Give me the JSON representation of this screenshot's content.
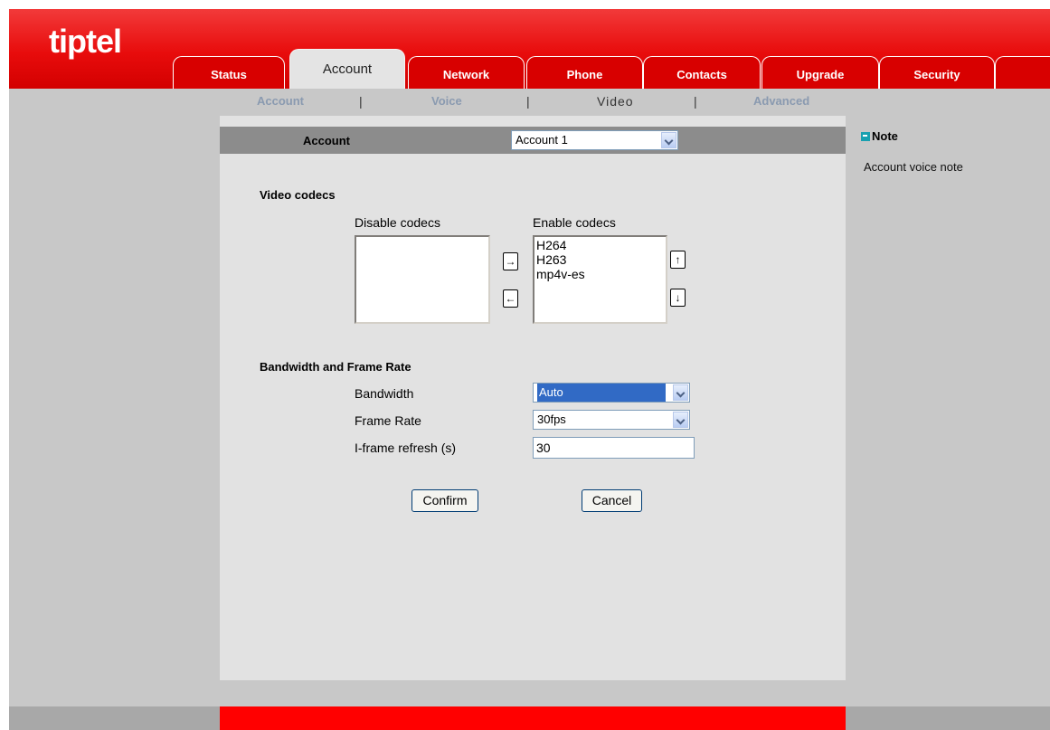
{
  "logo": "tiptel",
  "tabs": [
    "Status",
    "Account",
    "Network",
    "Phone",
    "Contacts",
    "Upgrade",
    "Security"
  ],
  "subtabs": [
    "Account",
    "Voice",
    "Video",
    "Advanced"
  ],
  "separator": "|",
  "account": {
    "label": "Account",
    "selected": "Account 1"
  },
  "video_codecs": {
    "title": "Video codecs",
    "disable_label": "Disable codecs",
    "enable_label": "Enable codecs",
    "disabled": [],
    "enabled": [
      "H264",
      "H263",
      "mp4v-es"
    ],
    "move_right": "→",
    "move_left": "←",
    "move_up": "↑",
    "move_down": "↓"
  },
  "bandwidth": {
    "title": "Bandwidth and Frame Rate",
    "bandwidth_label": "Bandwidth",
    "bandwidth_value": "Auto",
    "framerate_label": "Frame Rate",
    "framerate_value": "30fps",
    "iframe_label": "I-frame refresh (s)",
    "iframe_value": "30"
  },
  "buttons": {
    "confirm": "Confirm",
    "cancel": "Cancel"
  },
  "note": {
    "title": "Note",
    "text": "Account voice note"
  },
  "colors": {
    "brand_red": "#e80c0c",
    "panel": "#e2e2e2",
    "sidebar": "#c8c8c8"
  }
}
